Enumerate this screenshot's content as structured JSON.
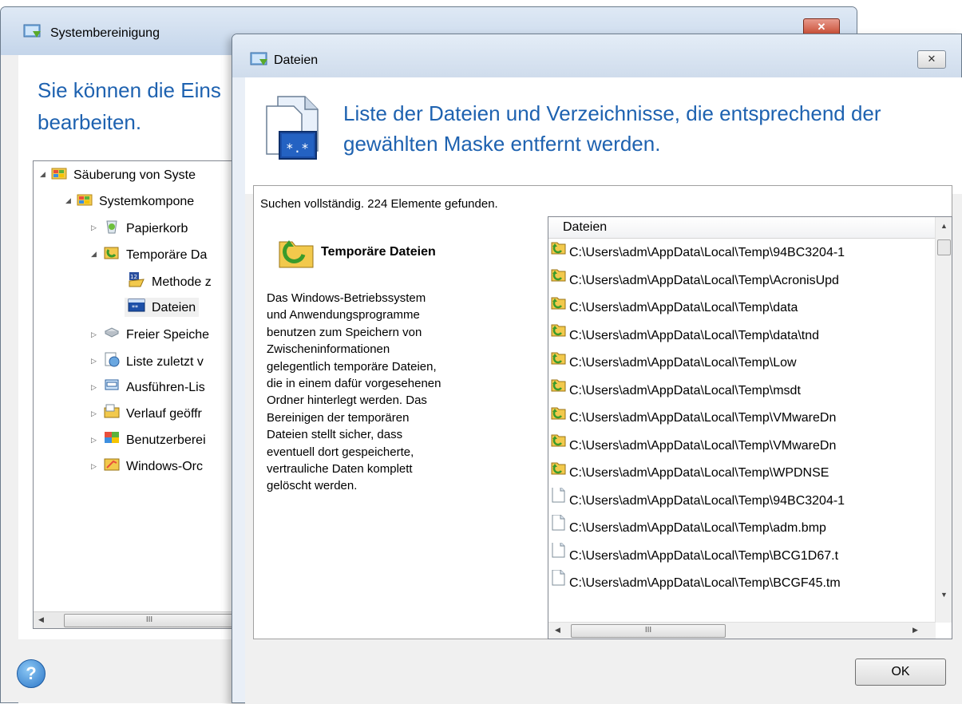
{
  "main_window": {
    "title": "Systembereinigung",
    "heading": "Sie können die Eins\nbearbeiten.",
    "close_glyph": "✕",
    "tree": [
      {
        "label": "Säuberung von Syste",
        "icon": "windows-folder-icon"
      },
      {
        "label": "Systemkompone",
        "icon": "windows-folder-icon"
      },
      {
        "label": "Papierkorb",
        "icon": "recycle-bin-icon"
      },
      {
        "label": "Temporäre Da",
        "icon": "temp-files-icon"
      },
      {
        "label": "Methode z",
        "icon": "method-icon"
      },
      {
        "label": "Dateien",
        "icon": "files-mask-icon"
      },
      {
        "label": "Freier Speiche",
        "icon": "disk-icon"
      },
      {
        "label": "Liste zuletzt v",
        "icon": "recent-list-icon"
      },
      {
        "label": "Ausführen-Lis",
        "icon": "run-list-icon"
      },
      {
        "label": "Verlauf geöffr",
        "icon": "history-folder-icon"
      },
      {
        "label": "Benutzerberei",
        "icon": "user-area-icon"
      },
      {
        "label": "Windows-Orc",
        "icon": "windows-folder-icon"
      }
    ],
    "scroll_thumb_glyph": "III",
    "help_glyph": "?"
  },
  "dialog": {
    "title": "Dateien",
    "close_glyph": "✕",
    "heading": "Liste der Dateien und Verzeichnisse, die entsprechend der gewählten Maske entfernt werden.",
    "status": "Suchen vollständig. 224 Elemente gefunden.",
    "category_name": "Temporäre Dateien",
    "category_description": "Das Windows-Betriebssystem\nund Anwendungsprogramme\nbenutzen zum Speichern von\nZwischeninformationen\ngelegentlich temporäre Dateien,\ndie in einem dafür vorgesehenen\nOrdner hinterlegt werden. Das\nBereinigen der temporären\nDateien stellt sicher, dass\neventuell dort gespeicherte,\nvertrauliche Daten komplett\ngelöscht werden.",
    "list_column": "Dateien",
    "files": [
      {
        "path": "C:\\Users\\adm\\AppData\\Local\\Temp\\94BC3204-1",
        "icon": "temp-folder-icon"
      },
      {
        "path": "C:\\Users\\adm\\AppData\\Local\\Temp\\AcronisUpd",
        "icon": "temp-folder-icon"
      },
      {
        "path": "C:\\Users\\adm\\AppData\\Local\\Temp\\data",
        "icon": "temp-folder-icon"
      },
      {
        "path": "C:\\Users\\adm\\AppData\\Local\\Temp\\data\\tnd",
        "icon": "temp-folder-icon"
      },
      {
        "path": "C:\\Users\\adm\\AppData\\Local\\Temp\\Low",
        "icon": "temp-folder-icon"
      },
      {
        "path": "C:\\Users\\adm\\AppData\\Local\\Temp\\msdt",
        "icon": "temp-folder-icon"
      },
      {
        "path": "C:\\Users\\adm\\AppData\\Local\\Temp\\VMwareDn",
        "icon": "temp-folder-icon"
      },
      {
        "path": "C:\\Users\\adm\\AppData\\Local\\Temp\\VMwareDn",
        "icon": "temp-folder-icon"
      },
      {
        "path": "C:\\Users\\adm\\AppData\\Local\\Temp\\WPDNSE",
        "icon": "temp-folder-icon"
      },
      {
        "path": "C:\\Users\\adm\\AppData\\Local\\Temp\\94BC3204-1",
        "icon": "file-icon"
      },
      {
        "path": "C:\\Users\\adm\\AppData\\Local\\Temp\\adm.bmp",
        "icon": "file-icon"
      },
      {
        "path": "C:\\Users\\adm\\AppData\\Local\\Temp\\BCG1D67.t",
        "icon": "file-icon"
      },
      {
        "path": "C:\\Users\\adm\\AppData\\Local\\Temp\\BCGF45.tm",
        "icon": "file-icon"
      }
    ],
    "scroll_thumb_glyph": "III",
    "ok_label": "OK"
  },
  "colors": {
    "heading_blue": "#1e62b0",
    "window_bg": "#f0f0f0",
    "close_red": "#c84a30"
  }
}
